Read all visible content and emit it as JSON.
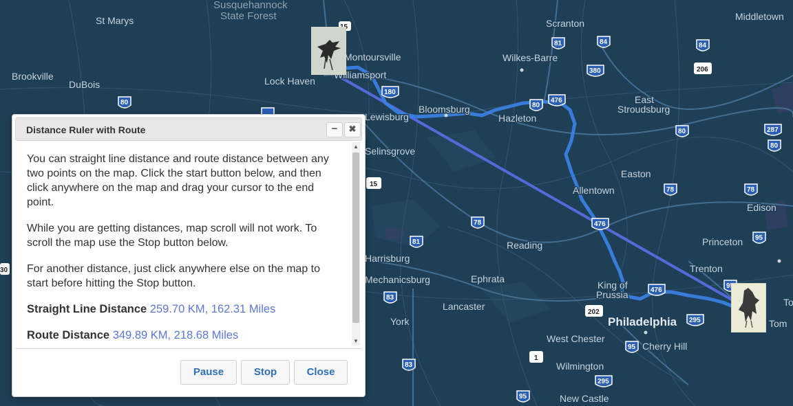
{
  "map": {
    "labels": {
      "susquehannock": "Susquehannock",
      "state_forest": "State Forest",
      "st_marys": "St Marys",
      "brookville": "Brookville",
      "dubois": "DuBois",
      "lock_haven": "Lock Haven",
      "montoursville": "Montoursville",
      "williamsport": "Williamsport",
      "scranton": "Scranton",
      "wilkes_barre": "Wilkes-Barre",
      "middletown": "Middletown",
      "bloomsburg": "Bloomsburg",
      "lewisburg": "Lewisburg",
      "hazleton": "Hazleton",
      "east_stroudsburg_1": "East",
      "east_stroudsburg_2": "Stroudsburg",
      "selinsgrove": "Selinsgrove",
      "easton": "Easton",
      "allentown": "Allentown",
      "edison": "Edison",
      "princeton": "Princeton",
      "reading": "Reading",
      "harrisburg": "Harrisburg",
      "mechanicsburg": "Mechanicsburg",
      "ephrata": "Ephrata",
      "trenton": "Trenton",
      "king_of_prussia_1": "King of",
      "king_of_prussia_2": "Prussia",
      "lancaster": "Lancaster",
      "york": "York",
      "philadelphia": "Philadelphia",
      "west_chester": "West Chester",
      "cherry_hill": "Cherry Hill",
      "wilmington": "Wilmington",
      "new_castle": "New Castle",
      "toms_1": "To",
      "toms_2": "Tom"
    },
    "shields": {
      "i15": "15",
      "i81a": "81",
      "i84a": "84",
      "i84b": "84",
      "i180": "180",
      "i80a": "80",
      "i80b": "80",
      "i476a": "476",
      "i80c": "80",
      "i287": "287",
      "i80d": "80",
      "i80e": "80",
      "i380": "380",
      "i78a": "78",
      "i78b": "78",
      "i78c": "78",
      "i81b": "81",
      "i476b": "476",
      "i476c": "476",
      "i295a": "295",
      "i295b": "295",
      "i95a": "95",
      "i95b": "95",
      "i95c": "95",
      "i95d": "95",
      "i83a": "83",
      "i83b": "83",
      "i206": "206",
      "us202": "202",
      "us15": "15",
      "us1": "1",
      "us30": "30",
      "i95e": "95"
    },
    "route": {
      "color": "#3a7fe0",
      "straight_line_color": "#5b6fe8"
    },
    "start_marker": "bird-drawing",
    "end_marker": "bird-drawing"
  },
  "dialog": {
    "title": "Distance Ruler with Route",
    "minimize": "−",
    "close_x": "✖",
    "paragraphs": [
      "You can straight line distance and route distance between any two points on the map. Click the start button below, and then click anywhere on the map and drag your cursor to the end point.",
      "While you are getting distances, map scroll will not work. To scroll the map use the Stop button below.",
      "For another distance, just click anywhere else on the map to start before hitting the Stop button."
    ],
    "straight_label": "Straight Line Distance",
    "straight_value": "259.70 KM, 162.31 Miles",
    "route_label": "Route Distance",
    "route_value": "349.89 KM, 218.68 Miles",
    "buttons": {
      "pause": "Pause",
      "stop": "Stop",
      "close": "Close"
    }
  },
  "colors": {
    "map_background": "#1f3f57",
    "link_blue": "#5d77d4",
    "button_text": "#2e6fb8"
  }
}
